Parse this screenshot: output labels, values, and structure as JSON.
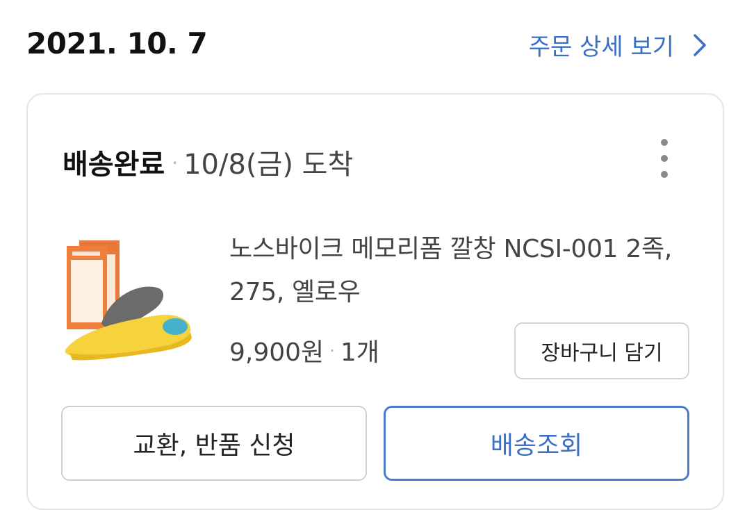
{
  "order": {
    "date": "2021. 10. 7",
    "detail_link": "주문 상세 보기"
  },
  "shipment": {
    "status": "배송완료",
    "separator": "·",
    "arrival": "10/8(금) 도착"
  },
  "product": {
    "name": "노스바이크 메모리폼 깔창 NCSI-001 2족, 275, 옐로우",
    "price": "9,900원",
    "separator": "·",
    "quantity": "1개"
  },
  "actions": {
    "add_to_cart": "장바구니 담기",
    "exchange_return": "교환, 반품 신청",
    "track_delivery": "배송조회"
  },
  "colors": {
    "accent_blue": "#3a6fc4",
    "border": "#e4e4e4"
  },
  "icons": {
    "detail_arrow": "chevron-right-icon",
    "more_menu": "kebab-menu-icon"
  }
}
